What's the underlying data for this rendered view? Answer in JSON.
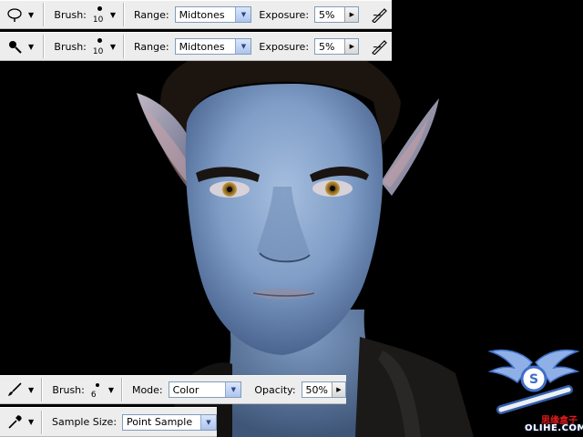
{
  "toolbars": {
    "dodge": {
      "tool_icon": "dodge-tool-icon",
      "brush_label": "Brush:",
      "brush_size": "10",
      "range_label": "Range:",
      "range_value": "Midtones",
      "exposure_label": "Exposure:",
      "exposure_value": "5%",
      "airbrush_icon": "airbrush-icon"
    },
    "burn": {
      "tool_icon": "burn-tool-icon",
      "brush_label": "Brush:",
      "brush_size": "10",
      "range_label": "Range:",
      "range_value": "Midtones",
      "exposure_label": "Exposure:",
      "exposure_value": "5%",
      "airbrush_icon": "airbrush-icon"
    },
    "color_brush": {
      "tool_icon": "brush-tool-icon",
      "brush_label": "Brush:",
      "brush_size": "6",
      "mode_label": "Mode:",
      "mode_value": "Color",
      "opacity_label": "Opacity:",
      "opacity_value": "50%"
    },
    "eyedropper": {
      "tool_icon": "eyedropper-tool-icon",
      "sample_size_label": "Sample Size:",
      "sample_size_value": "Point Sample"
    }
  },
  "canvas": {
    "subject": "portrait"
  },
  "watermark": {
    "site_text": "OLIHE.COM",
    "red_text": "思缘盒子"
  },
  "colors": {
    "toolbar_bg": "#ededed",
    "skin_blue": "#7f9fc8",
    "background": "#000000",
    "watermark_blue": "#3f6fc7"
  }
}
